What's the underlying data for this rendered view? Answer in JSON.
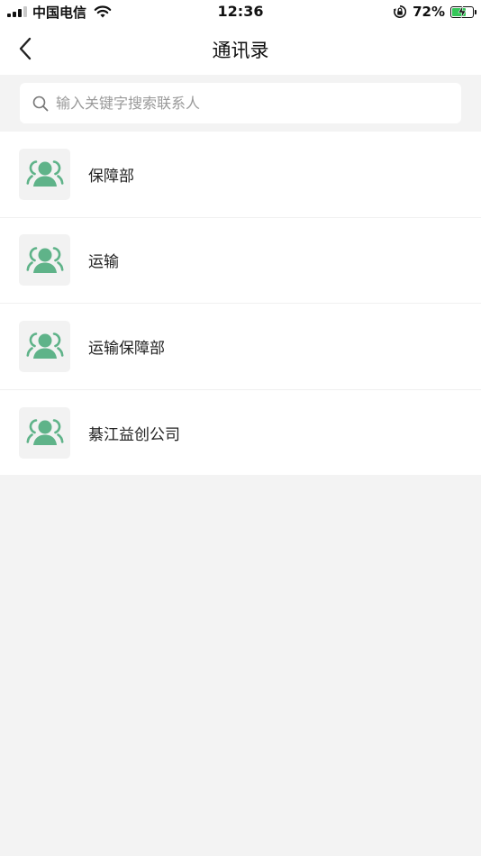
{
  "status_bar": {
    "carrier": "中国电信",
    "time": "12:36",
    "battery_percent": "72%"
  },
  "nav": {
    "title": "通讯录",
    "back_icon": "chevron-left-icon"
  },
  "search": {
    "placeholder": "输入关键字搜索联系人",
    "value": ""
  },
  "contacts": [
    {
      "name": "保障部",
      "icon": "group-icon"
    },
    {
      "name": "运输",
      "icon": "group-icon"
    },
    {
      "name": "运输保障部",
      "icon": "group-icon"
    },
    {
      "name": "綦江益创公司",
      "icon": "group-icon"
    }
  ],
  "colors": {
    "accent": "#5fb389",
    "background": "#f3f3f3",
    "avatar_bg": "#f2f2f2"
  }
}
